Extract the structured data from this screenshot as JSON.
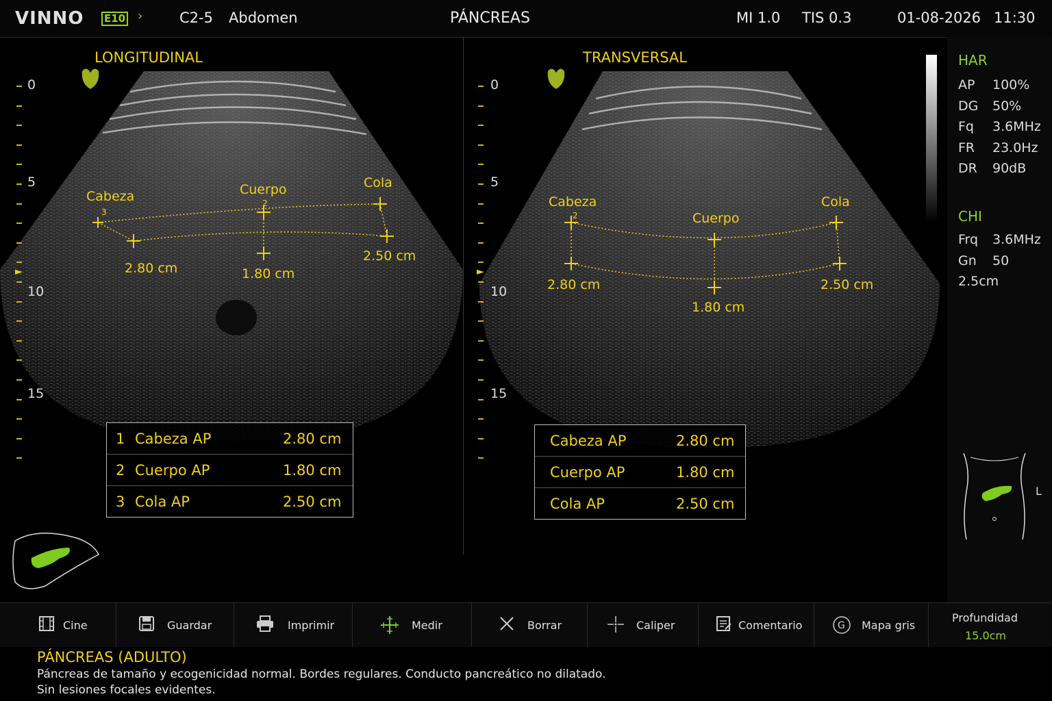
{
  "header": {
    "logo": "VINNO",
    "logo_model": "E10",
    "probe": "C2-5",
    "preset": "Abdomen",
    "exam_title": "PÁNCREAS",
    "mi": "MI 1.0",
    "tis": "TIS 0.3",
    "date": "01-08-2026",
    "time": "11:30"
  },
  "left_view": {
    "title": "LONGITUDINAL",
    "depth_labels": [
      "0",
      "5",
      "10",
      "15"
    ],
    "calipers": {
      "head_label": "Cabeza",
      "head_index": "3",
      "body_label": "Cuerpo",
      "body_index": "2",
      "tail_label": "Cola",
      "head_value": "2.80 cm",
      "body_value": "1.80 cm",
      "tail_value": "2.50 cm"
    },
    "table": [
      {
        "index": "1",
        "name": "Cabeza AP",
        "value": "2.80 cm"
      },
      {
        "index": "2",
        "name": "Cuerpo AP",
        "value": "1.80 cm"
      },
      {
        "index": "3",
        "name": "Cola AP",
        "value": "2.50 cm"
      }
    ]
  },
  "right_view": {
    "title": "TRANSVERSAL",
    "depth_labels": [
      "0",
      "5",
      "10",
      "15"
    ],
    "calipers": {
      "head_label": "Cabeza",
      "head_index": "2",
      "body_label": "Cuerpo",
      "tail_label": "Cola",
      "head_value": "2.80 cm",
      "body_value": "1.80 cm",
      "tail_value": "2.50 cm"
    },
    "table": [
      {
        "name": "Cabeza AP",
        "value": "2.80 cm"
      },
      {
        "name": "Cuerpo AP",
        "value": "1.80 cm"
      },
      {
        "name": "Cola AP",
        "value": "2.50 cm"
      }
    ]
  },
  "params": {
    "har_title": "HAR",
    "har": [
      {
        "k": "AP",
        "v": "100%"
      },
      {
        "k": "DG",
        "v": "50%"
      },
      {
        "k": "Fq",
        "v": "3.6MHz"
      },
      {
        "k": "FR",
        "v": "23.0Hz"
      },
      {
        "k": "DR",
        "v": "90dB"
      }
    ],
    "chi_title": "CHI",
    "chi": [
      {
        "k": "Frq",
        "v": "3.6MHz"
      },
      {
        "k": "Gn",
        "v": "50"
      }
    ],
    "chi_extra": "2.5cm",
    "body_marker_side": "L"
  },
  "toolbar": {
    "items": [
      {
        "label": "Cine",
        "icon": "film-icon"
      },
      {
        "label": "Guardar",
        "icon": "save-icon"
      },
      {
        "label": "Imprimir",
        "icon": "printer-icon"
      },
      {
        "label": "Medir",
        "icon": "measure-icon"
      },
      {
        "label": "Borrar",
        "icon": "close-icon"
      },
      {
        "label": "Caliper",
        "icon": "crosshair-icon"
      },
      {
        "label": "Comentario",
        "icon": "comment-icon"
      },
      {
        "label": "Mapa gris",
        "icon": "grayscale-icon"
      }
    ],
    "depth_label": "Profundidad",
    "depth_value": "15.0cm"
  },
  "report": {
    "title": "PÁNCREAS (ADULTO)",
    "line1": "Páncreas de tamaño y ecogenicidad normal. Bordes regulares. Conducto pancreático no dilatado.",
    "line2": "Sin lesiones focales evidentes."
  },
  "colors": {
    "caliper": "#f2d11b",
    "accent_green": "#8fd230"
  }
}
